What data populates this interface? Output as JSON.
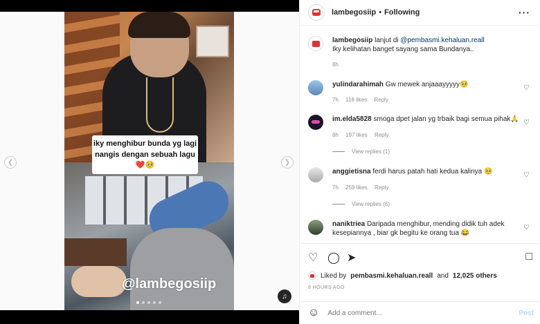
{
  "post": {
    "username": "lambegosiip",
    "follow_status": "Following",
    "more_icon": "more-dots-icon"
  },
  "media": {
    "caption_line1": "iky menghibur bunda yg lagi",
    "caption_line2": "nangis dengan sebuah lagu",
    "caption_emoji": "❤️🥺",
    "watermark": "@lambegosiip"
  },
  "caption": {
    "username": "lambegosiip",
    "text_prefix": "lanjut di",
    "mention": "@pembasmi.kehaluan.reall",
    "text_line2": "Iky kelihatan banget sayang sama Bundanya..",
    "age": "8h"
  },
  "comments": [
    {
      "username": "yulindarahimah",
      "text": "Gw mewek anjaaayyyyy🥺",
      "age": "7h",
      "likes": "118 likes",
      "reply": "Reply",
      "avatar_color": "#7aa7d6"
    },
    {
      "username": "im.elda5828",
      "text": "smoga dpet jalan yg trbaik bagi semua pihak🙏",
      "age": "8h",
      "likes": "197 likes",
      "reply": "Reply",
      "view_replies": "View replies (1)",
      "avatar_color": "#2a1e3a"
    },
    {
      "username": "anggietisna",
      "text": "ferdi harus patah hati kedua kalinya 🥺",
      "age": "7h",
      "likes": "259 likes",
      "reply": "Reply",
      "view_replies": "View replies (6)",
      "avatar_color": "#c9c9c9"
    },
    {
      "username": "naniktriea",
      "text": "Daripada menghibur, mending didik tuh adek kesepiannya , biar gk begitu ke orang tua 😂",
      "avatar_color": "#4f6b45"
    }
  ],
  "actions": {
    "like_icon": "heart-icon",
    "comment_icon": "comment-icon",
    "share_icon": "send-icon",
    "save_icon": "bookmark-icon"
  },
  "likes": {
    "prefix": "Liked by",
    "user": "pembasmi.kehaluan.reall",
    "and": "and",
    "others": "12,025 others"
  },
  "timestamp": "8 HOURS AGO",
  "add_comment": {
    "placeholder": "Add a comment...",
    "post_label": "Post"
  },
  "colors": {
    "post_button": "#b3dbff",
    "meta_text": "#8e8e8e",
    "heart": "#e0283a"
  }
}
